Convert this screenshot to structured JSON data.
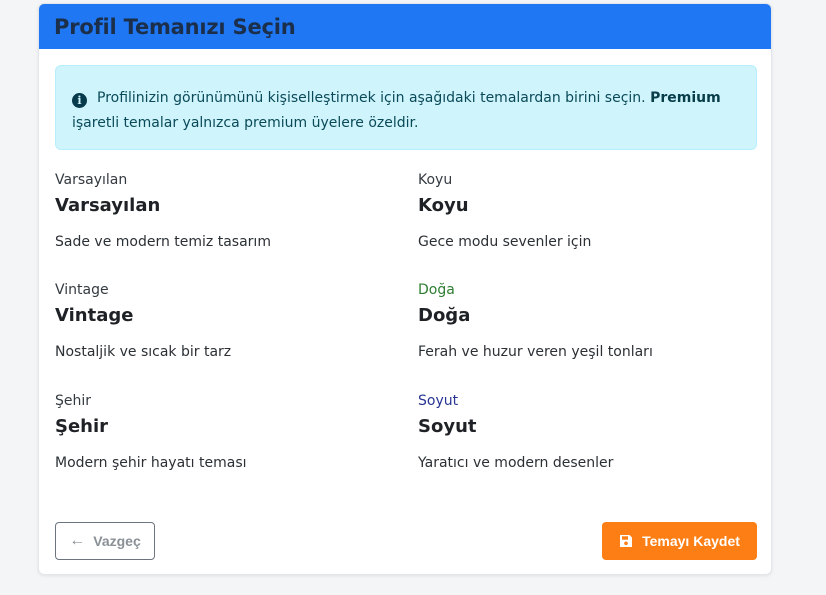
{
  "card": {
    "title": "Profil Temanızı Seçin"
  },
  "alert": {
    "icon": "info-circle-icon",
    "text_before": "Profilinizin görünümünü kişiselleştirmek için aşağıdaki temalardan birini seçin.",
    "highlight": "Premium",
    "text_after": "işaretli temalar yalnızca premium üyelere özeldir."
  },
  "themes": [
    {
      "label": "Varsayılan",
      "name": "Varsayılan",
      "description": "Sade ve modern temiz tasarım",
      "label_color": "#333a40"
    },
    {
      "label": "Koyu",
      "name": "Koyu",
      "description": "Gece modu sevenler için",
      "label_color": "#333a40"
    },
    {
      "label": "Vintage",
      "name": "Vintage",
      "description": "Nostaljik ve sıcak bir tarz",
      "label_color": "#333a40"
    },
    {
      "label": "Doğa",
      "name": "Doğa",
      "description": "Ferah ve huzur veren yeşil tonları",
      "label_color": "#2e7d32"
    },
    {
      "label": "Şehir",
      "name": "Şehir",
      "description": "Modern şehir hayatı teması",
      "label_color": "#333a40"
    },
    {
      "label": "Soyut",
      "name": "Soyut",
      "description": "Yaratıcı ve modern desenler",
      "label_color": "#283593"
    }
  ],
  "buttons": {
    "cancel_label": "Vazgeç",
    "cancel_icon": "arrow-left-icon",
    "save_label": "Temayı Kaydet",
    "save_icon": "save-icon"
  },
  "colors": {
    "header": "#1f77f3",
    "alert_bg": "#cff4fc",
    "save_button": "#fd7e14"
  }
}
